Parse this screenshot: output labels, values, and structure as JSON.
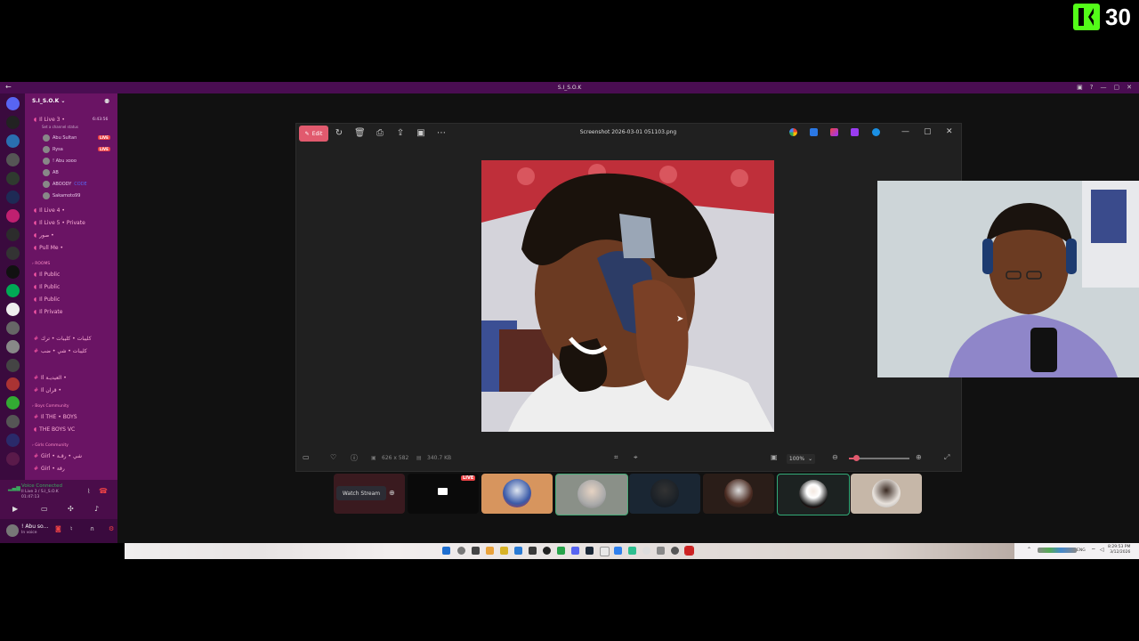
{
  "overlay": {
    "kick_count": "30"
  },
  "discord": {
    "title": "S.I_S.O.K",
    "server_name": "S.I_S.O.K",
    "channels": [
      {
        "label": "Il Live 3 •",
        "time": "6:43:56"
      },
      {
        "label": "Set a channel status"
      },
      {
        "label": "Il Live 4 •"
      },
      {
        "label": "Il Live 5 • Private"
      },
      {
        "label": "صور •"
      },
      {
        "label": "Pull Me •"
      },
      {
        "label": "Il Public"
      },
      {
        "label": "Il Public"
      },
      {
        "label": "Il Public"
      },
      {
        "label": "Il Private"
      },
      {
        "label": "كليبات • كليبات • ترك"
      },
      {
        "label": "كليبات • شي • ضب"
      },
      {
        "label": "Il العيديـة •"
      },
      {
        "label": "Il قران •"
      },
      {
        "label": "Il THE • BOYS"
      },
      {
        "label": "THE BOYS VC"
      },
      {
        "label": "Girl • شي • رقـة"
      },
      {
        "label": "Girl • رقة"
      }
    ],
    "categories": [
      "ROOMS",
      "Boys Community",
      "Girls Community"
    ],
    "users": [
      {
        "name": "Abu Sultan",
        "badge": "LIVE"
      },
      {
        "name": "Rysa",
        "badge": "LIVE"
      },
      {
        "name": "! Abu xooo"
      },
      {
        "name": "AB"
      },
      {
        "name": "ABOODY",
        "tag": "CODE"
      },
      {
        "name": "Sakamoto99"
      }
    ],
    "voice": {
      "title": "Voice Connected",
      "channel": "Il Live 3 / S.I_S.O.K",
      "time": "01:47:13"
    },
    "me": {
      "name": "! Abu so...",
      "status": "In voice"
    }
  },
  "viewer": {
    "edit_label": "Edit",
    "filename": "Screenshot 2026-03-01 051103.png",
    "dimensions": "626 x 582",
    "file_size": "340.7 KB",
    "zoom": "100%",
    "zoom_level": 0.12
  },
  "tiles": {
    "watch_label": "Watch Stream",
    "live_label": "LIVE"
  },
  "taskbar": {
    "time": "8:29:53 PM",
    "date": "3/12/2026",
    "lang": "ENG"
  }
}
